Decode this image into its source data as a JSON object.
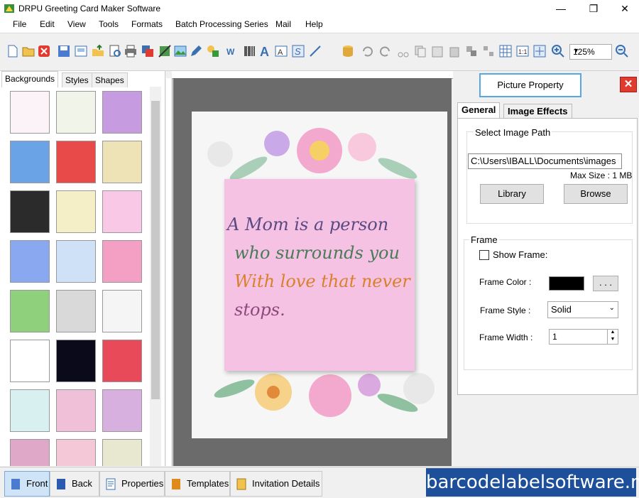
{
  "window": {
    "title": "DRPU Greeting Card Maker Software",
    "minimize": "—",
    "maximize": "❐",
    "close": "✕"
  },
  "menu": [
    "File",
    "Edit",
    "View",
    "Tools",
    "Formats",
    "Batch Processing Series",
    "Mail",
    "Help"
  ],
  "toolbar": {
    "zoom": "125%"
  },
  "left_panel": {
    "tabs": [
      "Backgrounds",
      "Styles",
      "Shapes"
    ],
    "active_tab": "Backgrounds",
    "thumbnails": [
      "#fbf3f7",
      "#f1f4e8",
      "#c69be0",
      "#6aa4e7",
      "#e84a4a",
      "#eee2b7",
      "#2b2b2b",
      "#f4efc6",
      "#f8c8e6",
      "#8aa8f0",
      "#cfe1f6",
      "#f3a0c4",
      "#8ed07c",
      "#d9d9d9",
      "#f5f5f5",
      "#ffffff",
      "#0a0a1a",
      "#e84a5a",
      "#d8f0f0",
      "#f0c0d8",
      "#d8b0e0",
      "#e0a8c8",
      "#f5c8d8",
      "#e8e8d0"
    ]
  },
  "card": {
    "line1": "A Mom is a person",
    "line2": "who surrounds you",
    "line3": "With love that never",
    "line4": "stops."
  },
  "right_panel": {
    "picture_property": "Picture Property",
    "close_icon": "✕",
    "tabs": [
      "General",
      "Image Effects"
    ],
    "image_path": {
      "label": "Select Image Path",
      "value": "C:\\Users\\IBALL\\Documents\\images",
      "max_size": "Max Size : 1 MB",
      "library": "Library",
      "browse": "Browse"
    },
    "frame": {
      "label": "Frame",
      "show_frame": "Show Frame:",
      "color_label": "Frame Color :",
      "color": "#000000",
      "more": ". . .",
      "style_label": "Frame Style :",
      "style_value": "Solid",
      "width_label": "Frame Width :",
      "width_value": "1"
    }
  },
  "status_bar": {
    "front": "Front",
    "back": "Back",
    "properties": "Properties",
    "templates": "Templates",
    "invitation_details": "Invitation Details",
    "brand": "barcodelabelsoftware.net"
  }
}
